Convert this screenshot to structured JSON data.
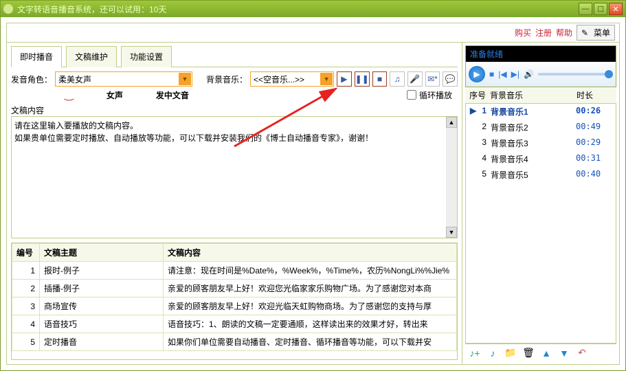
{
  "window": {
    "title": "文字转语音播音系统，还可以试用：10天"
  },
  "topLinks": {
    "buy": "购买",
    "register": "注册",
    "help": "帮助",
    "menu": "菜单"
  },
  "tabs": [
    "即时播音",
    "文稿维护",
    "功能设置"
  ],
  "voiceRow": {
    "roleLabel": "发音角色：",
    "roleValue": "柔美女声",
    "bgLabel": "背景音乐：",
    "bgValue": "<<空音乐...>>",
    "loopLabel": "循环播放",
    "sub1": "女声",
    "sub2": "发中文音"
  },
  "contentLabel": "文稿内容",
  "textareaValue": "请在这里输入要播放的文稿内容。\n如果贵单位需要定时播放、自动播放等功能，可以下载并安装我们的《博士自动播音专家》，谢谢！",
  "docTable": {
    "headers": [
      "编号",
      "文稿主题",
      "文稿内容"
    ],
    "rows": [
      {
        "id": 1,
        "title": "报时-例子",
        "content": "请注意：现在时间是%Date%，%Week%，%Time%，农历%NongLi%%Jie%"
      },
      {
        "id": 2,
        "title": "插播-例子",
        "content": "亲爱的顾客朋友早上好！欢迎您光临家家乐购物广场。为了感谢您对本商"
      },
      {
        "id": 3,
        "title": "商场宣传",
        "content": "亲爱的顾客朋友早上好！欢迎光临天虹购物商场。为了感谢您的支持与厚"
      },
      {
        "id": 4,
        "title": "语音技巧",
        "content": "语音技巧：1、朗读的文稿一定要通顺，这样读出来的效果才好，转出来"
      },
      {
        "id": 5,
        "title": "定时播音",
        "content": "如果你们单位需要自动播音、定时播音、循环播音等功能，可以下载并安"
      }
    ]
  },
  "player": {
    "status": "准备就绪"
  },
  "trackHeaders": {
    "no": "序号",
    "name": "背景音乐",
    "dur": "时长"
  },
  "tracks": [
    {
      "no": 1,
      "name": "背景音乐1",
      "dur": "00:26",
      "sel": true
    },
    {
      "no": 2,
      "name": "背景音乐2",
      "dur": "00:49",
      "sel": false
    },
    {
      "no": 3,
      "name": "背景音乐3",
      "dur": "00:29",
      "sel": false
    },
    {
      "no": 4,
      "name": "背景音乐4",
      "dur": "00:31",
      "sel": false
    },
    {
      "no": 5,
      "name": "背景音乐5",
      "dur": "00:40",
      "sel": false
    }
  ],
  "icons": {
    "play": "▶",
    "stop": "■",
    "pause": "❚❚",
    "note": "♫",
    "mic": "🎤",
    "new": "✉*",
    "chat": "💬",
    "prev": "|◀",
    "next": "▶|",
    "vol": "🔊",
    "addnote": "♪+",
    "addfile": "♪",
    "folder": "📁",
    "trash": "🗑",
    "up": "▲",
    "down": "▼",
    "undo": "↶"
  }
}
